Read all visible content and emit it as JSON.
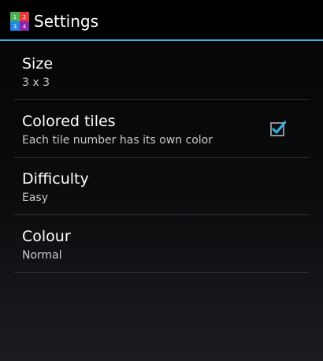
{
  "app": {
    "title": "Settings",
    "icon_digits": [
      "1",
      "2",
      "3",
      "4"
    ],
    "colors": {
      "accent": "#33b5e5",
      "icon_green": "#4caf50",
      "icon_red": "#e53935",
      "icon_blue": "#1e88e5",
      "icon_purple": "#8e24aa"
    }
  },
  "preferences": [
    {
      "title": "Size",
      "summary": "3 x 3"
    },
    {
      "title": "Colored tiles",
      "summary": "Each tile number has its own color",
      "checked": true
    },
    {
      "title": "Difficulty",
      "summary": "Easy"
    },
    {
      "title": "Colour",
      "summary": "Normal"
    }
  ]
}
